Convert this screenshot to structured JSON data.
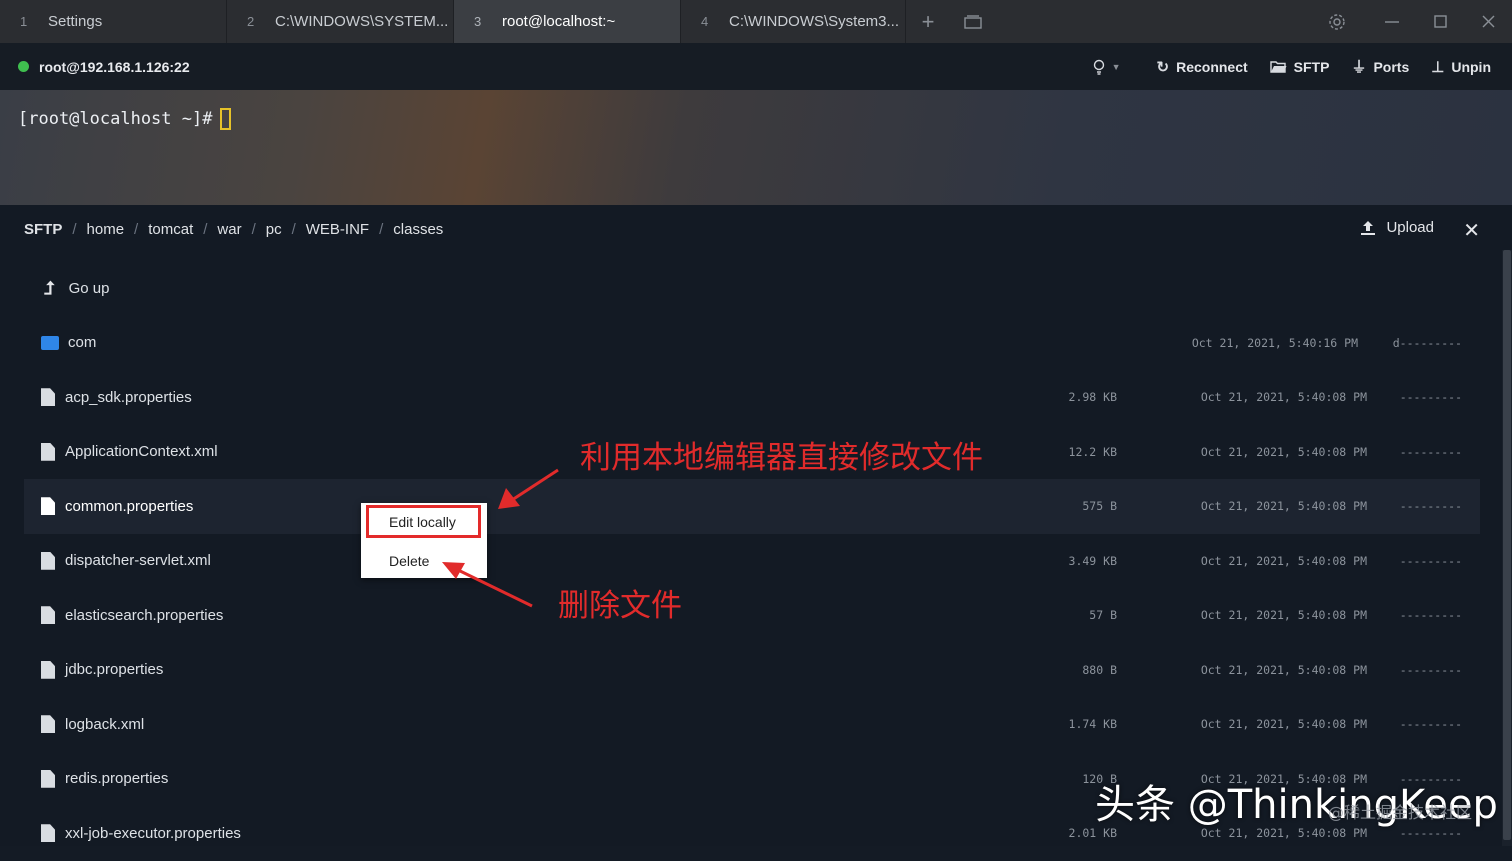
{
  "tabs": [
    {
      "num": "1",
      "label": "Settings"
    },
    {
      "num": "2",
      "label": "C:\\WINDOWS\\SYSTEM..."
    },
    {
      "num": "3",
      "label": "root@localhost:~"
    },
    {
      "num": "4",
      "label": "C:\\WINDOWS\\System3..."
    }
  ],
  "session": {
    "host": "root@192.168.1.126:22",
    "status_color": "#3fbf4f",
    "actions": {
      "reconnect": "Reconnect",
      "sftp": "SFTP",
      "ports": "Ports",
      "unpin": "Unpin"
    }
  },
  "terminal": {
    "prompt": "[root@localhost ~]#"
  },
  "sftp": {
    "breadcrumb": [
      "SFTP",
      "home",
      "tomcat",
      "war",
      "pc",
      "WEB-INF",
      "classes"
    ],
    "upload_label": "Upload",
    "go_up_label": "Go up",
    "files": [
      {
        "name": "com",
        "type": "folder",
        "size": "",
        "date": "Oct 21, 2021, 5:40:16 PM",
        "perm": "d---------"
      },
      {
        "name": "acp_sdk.properties",
        "type": "file",
        "size": "2.98 KB",
        "date": "Oct 21, 2021, 5:40:08 PM",
        "perm": "---------"
      },
      {
        "name": "ApplicationContext.xml",
        "type": "file",
        "size": "12.2 KB",
        "date": "Oct 21, 2021, 5:40:08 PM",
        "perm": "---------"
      },
      {
        "name": "common.properties",
        "type": "file",
        "size": "575 B",
        "date": "Oct 21, 2021, 5:40:08 PM",
        "perm": "---------"
      },
      {
        "name": "dispatcher-servlet.xml",
        "type": "file",
        "size": "3.49 KB",
        "date": "Oct 21, 2021, 5:40:08 PM",
        "perm": "---------"
      },
      {
        "name": "elasticsearch.properties",
        "type": "file",
        "size": "57 B",
        "date": "Oct 21, 2021, 5:40:08 PM",
        "perm": "---------"
      },
      {
        "name": "jdbc.properties",
        "type": "file",
        "size": "880 B",
        "date": "Oct 21, 2021, 5:40:08 PM",
        "perm": "---------"
      },
      {
        "name": "logback.xml",
        "type": "file",
        "size": "1.74 KB",
        "date": "Oct 21, 2021, 5:40:08 PM",
        "perm": "---------"
      },
      {
        "name": "redis.properties",
        "type": "file",
        "size": "120 B",
        "date": "Oct 21, 2021, 5:40:08 PM",
        "perm": "---------"
      },
      {
        "name": "xxl-job-executor.properties",
        "type": "file",
        "size": "2.01 KB",
        "date": "Oct 21, 2021, 5:40:08 PM",
        "perm": "---------"
      }
    ]
  },
  "context_menu": {
    "edit_locally": "Edit locally",
    "delete": "Delete"
  },
  "annotations": {
    "edit_note": "利用本地编辑器直接修改文件",
    "delete_note": "删除文件",
    "color": "#e12b2b"
  },
  "watermark": {
    "main": "头条 @ThinkingKeep",
    "sub": "@稀土掘金技术社区"
  }
}
